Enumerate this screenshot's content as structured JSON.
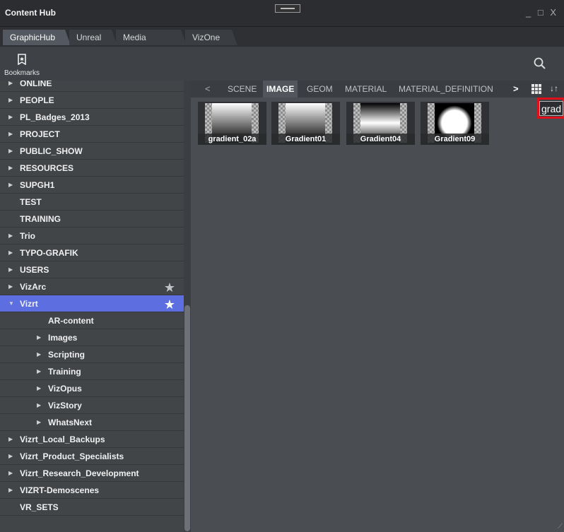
{
  "window": {
    "title": "Content Hub",
    "controls": "_ □ X"
  },
  "tabs": [
    {
      "label": "GraphicHub",
      "active": true
    },
    {
      "label": "Unreal",
      "active": false
    },
    {
      "label": "Media Service",
      "active": false
    },
    {
      "label": "VizOne",
      "active": false
    }
  ],
  "toolbar": {
    "bookmarks_label": "Bookmarks",
    "bookmarks_icon": "bookmark-icon",
    "search_icon": "search-icon"
  },
  "sidebar": {
    "items": [
      {
        "label": "ONLINE",
        "has_arrow": true,
        "expanded": false,
        "level": 0
      },
      {
        "label": "PEOPLE",
        "has_arrow": true,
        "expanded": false,
        "level": 0
      },
      {
        "label": "PL_Badges_2013",
        "has_arrow": true,
        "expanded": false,
        "level": 0
      },
      {
        "label": "PROJECT",
        "has_arrow": true,
        "expanded": false,
        "level": 0
      },
      {
        "label": "PUBLIC_SHOW",
        "has_arrow": true,
        "expanded": false,
        "level": 0
      },
      {
        "label": "RESOURCES",
        "has_arrow": true,
        "expanded": false,
        "level": 0
      },
      {
        "label": "SUPGH1",
        "has_arrow": true,
        "expanded": false,
        "level": 0
      },
      {
        "label": "TEST",
        "has_arrow": false,
        "expanded": false,
        "level": 0
      },
      {
        "label": "TRAINING",
        "has_arrow": false,
        "expanded": false,
        "level": 0
      },
      {
        "label": "Trio",
        "has_arrow": true,
        "expanded": false,
        "level": 0
      },
      {
        "label": "TYPO-GRAFIK",
        "has_arrow": true,
        "expanded": false,
        "level": 0
      },
      {
        "label": "USERS",
        "has_arrow": true,
        "expanded": false,
        "level": 0
      },
      {
        "label": "VizArc",
        "has_arrow": true,
        "expanded": false,
        "level": 0,
        "star": true
      },
      {
        "label": "Vizrt",
        "has_arrow": true,
        "expanded": true,
        "level": 0,
        "star": true,
        "selected": true
      },
      {
        "label": "AR-content",
        "has_arrow": false,
        "expanded": false,
        "level": 1
      },
      {
        "label": "Images",
        "has_arrow": true,
        "expanded": false,
        "level": 1
      },
      {
        "label": "Scripting",
        "has_arrow": true,
        "expanded": false,
        "level": 1
      },
      {
        "label": "Training",
        "has_arrow": true,
        "expanded": false,
        "level": 1
      },
      {
        "label": "VizOpus",
        "has_arrow": true,
        "expanded": false,
        "level": 1
      },
      {
        "label": "VizStory",
        "has_arrow": true,
        "expanded": false,
        "level": 1
      },
      {
        "label": "WhatsNext",
        "has_arrow": true,
        "expanded": false,
        "level": 1
      },
      {
        "label": "Vizrt_Local_Backups",
        "has_arrow": true,
        "expanded": false,
        "level": 0
      },
      {
        "label": "Vizrt_Product_Specialists",
        "has_arrow": true,
        "expanded": false,
        "level": 0
      },
      {
        "label": "Vizrt_Research_Development",
        "has_arrow": true,
        "expanded": false,
        "level": 0
      },
      {
        "label": "VIZRT-Demoscenes",
        "has_arrow": true,
        "expanded": false,
        "level": 0
      },
      {
        "label": "VR_SETS",
        "has_arrow": false,
        "expanded": false,
        "level": 0
      }
    ]
  },
  "content": {
    "type_tabs": [
      {
        "label": "SCENE",
        "active": false
      },
      {
        "label": "IMAGE",
        "active": true
      },
      {
        "label": "GEOM",
        "active": false
      },
      {
        "label": "MATERIAL",
        "active": false
      },
      {
        "label": "MATERIAL_DEFINITION",
        "active": false
      }
    ],
    "nav_prev": "<",
    "nav_next": ">",
    "sort_icon": "↓↑",
    "search": {
      "value": "grad",
      "placeholder": ""
    },
    "assets": [
      {
        "name": "gradient_02a",
        "preview": "linear-vertical"
      },
      {
        "name": "Gradient01",
        "preview": "linear-vertical"
      },
      {
        "name": "Gradient04",
        "preview": "symmetric-horizontal"
      },
      {
        "name": "Gradient09",
        "preview": "radial"
      }
    ]
  }
}
